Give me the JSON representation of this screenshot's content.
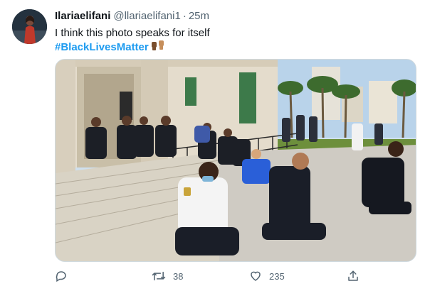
{
  "tweet": {
    "display_name": "Ilariaelifani",
    "handle": "@llariaelifani1",
    "separator": "·",
    "time": "25m",
    "text": "I think this photo speaks for itself",
    "hashtag": "#BlackLivesMatter",
    "emoji": "raised-fists-emoji"
  },
  "media": {
    "kind": "photo"
  },
  "actions": {
    "reply": {
      "icon": "reply-icon"
    },
    "retweet": {
      "icon": "retweet-icon",
      "count": "38"
    },
    "like": {
      "icon": "heart-icon",
      "count": "235"
    },
    "share": {
      "icon": "share-icon"
    }
  },
  "colors": {
    "link": "#1d9bf0",
    "secondary_text": "#536471",
    "primary_text": "#0f1419"
  }
}
